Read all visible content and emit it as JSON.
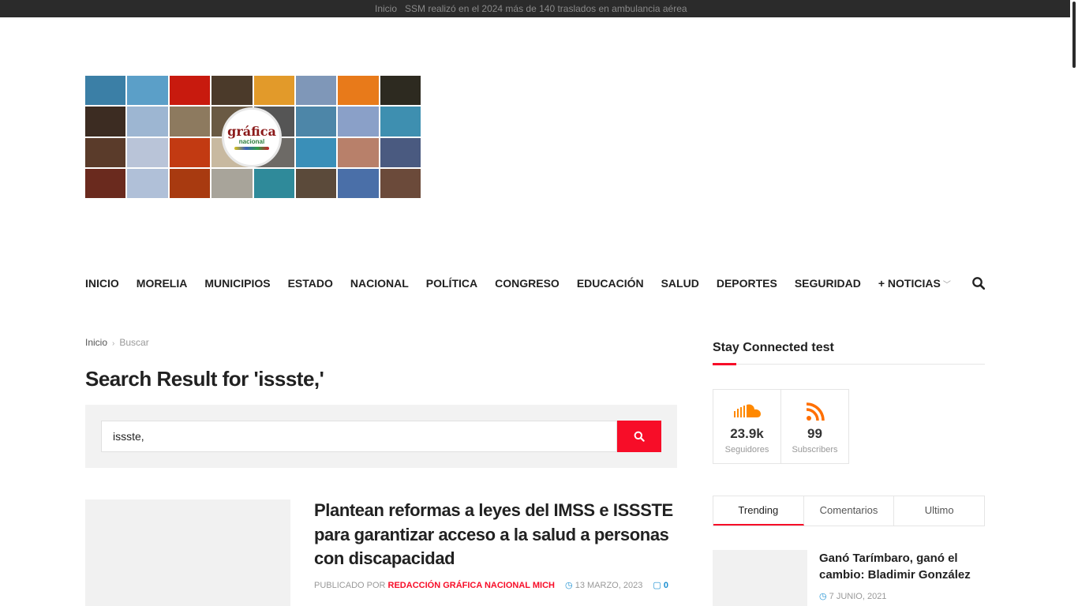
{
  "ticker": {
    "label": "Inicio",
    "headline": "SSM realizó en el 2024 más de 140 traslados en ambulancia aérea"
  },
  "logo": {
    "wordmark": "gráfica",
    "sub": "nacional"
  },
  "nav": {
    "items": [
      "INICIO",
      "MORELIA",
      "MUNICIPIOS",
      "ESTADO",
      "NACIONAL",
      "POLÍTICA",
      "CONGRESO",
      "EDUCACIÓN",
      "SALUD",
      "DEPORTES",
      "SEGURIDAD",
      "+ NOTICIAS"
    ],
    "search_icon": "search-icon"
  },
  "breadcrumb": {
    "home": "Inicio",
    "current": "Buscar"
  },
  "page_title": "Search Result for 'issste,'",
  "search": {
    "value": "issste,"
  },
  "article": {
    "title": "Plantean reformas a leyes del IMSS e ISSSTE para garantizar acceso a la salud a personas con discapacidad",
    "published_by": "PUBLICADO POR",
    "author": "REDACCIÓN GRÁFICA NACIONAL MICH",
    "date": "13 MARZO, 2023",
    "comments": "0"
  },
  "sidebar": {
    "title": "Stay Connected test",
    "social": [
      {
        "icon": "soundcloud-icon",
        "count": "23.9k",
        "label": "Seguidores",
        "color": "#ff8800"
      },
      {
        "icon": "rss-icon",
        "count": "99",
        "label": "Subscribers",
        "color": "#ff6f00"
      }
    ],
    "tabs": [
      "Trending",
      "Comentarios",
      "Ultimo"
    ],
    "trending": {
      "title": "Ganó Tarímbaro, ganó el cambio: Bladimir González",
      "date": "7 JUNIO, 2021"
    }
  },
  "colors": {
    "accent": "#f70d28",
    "link_blue": "#1a8fd1",
    "topbar": "#2b2b2b"
  }
}
